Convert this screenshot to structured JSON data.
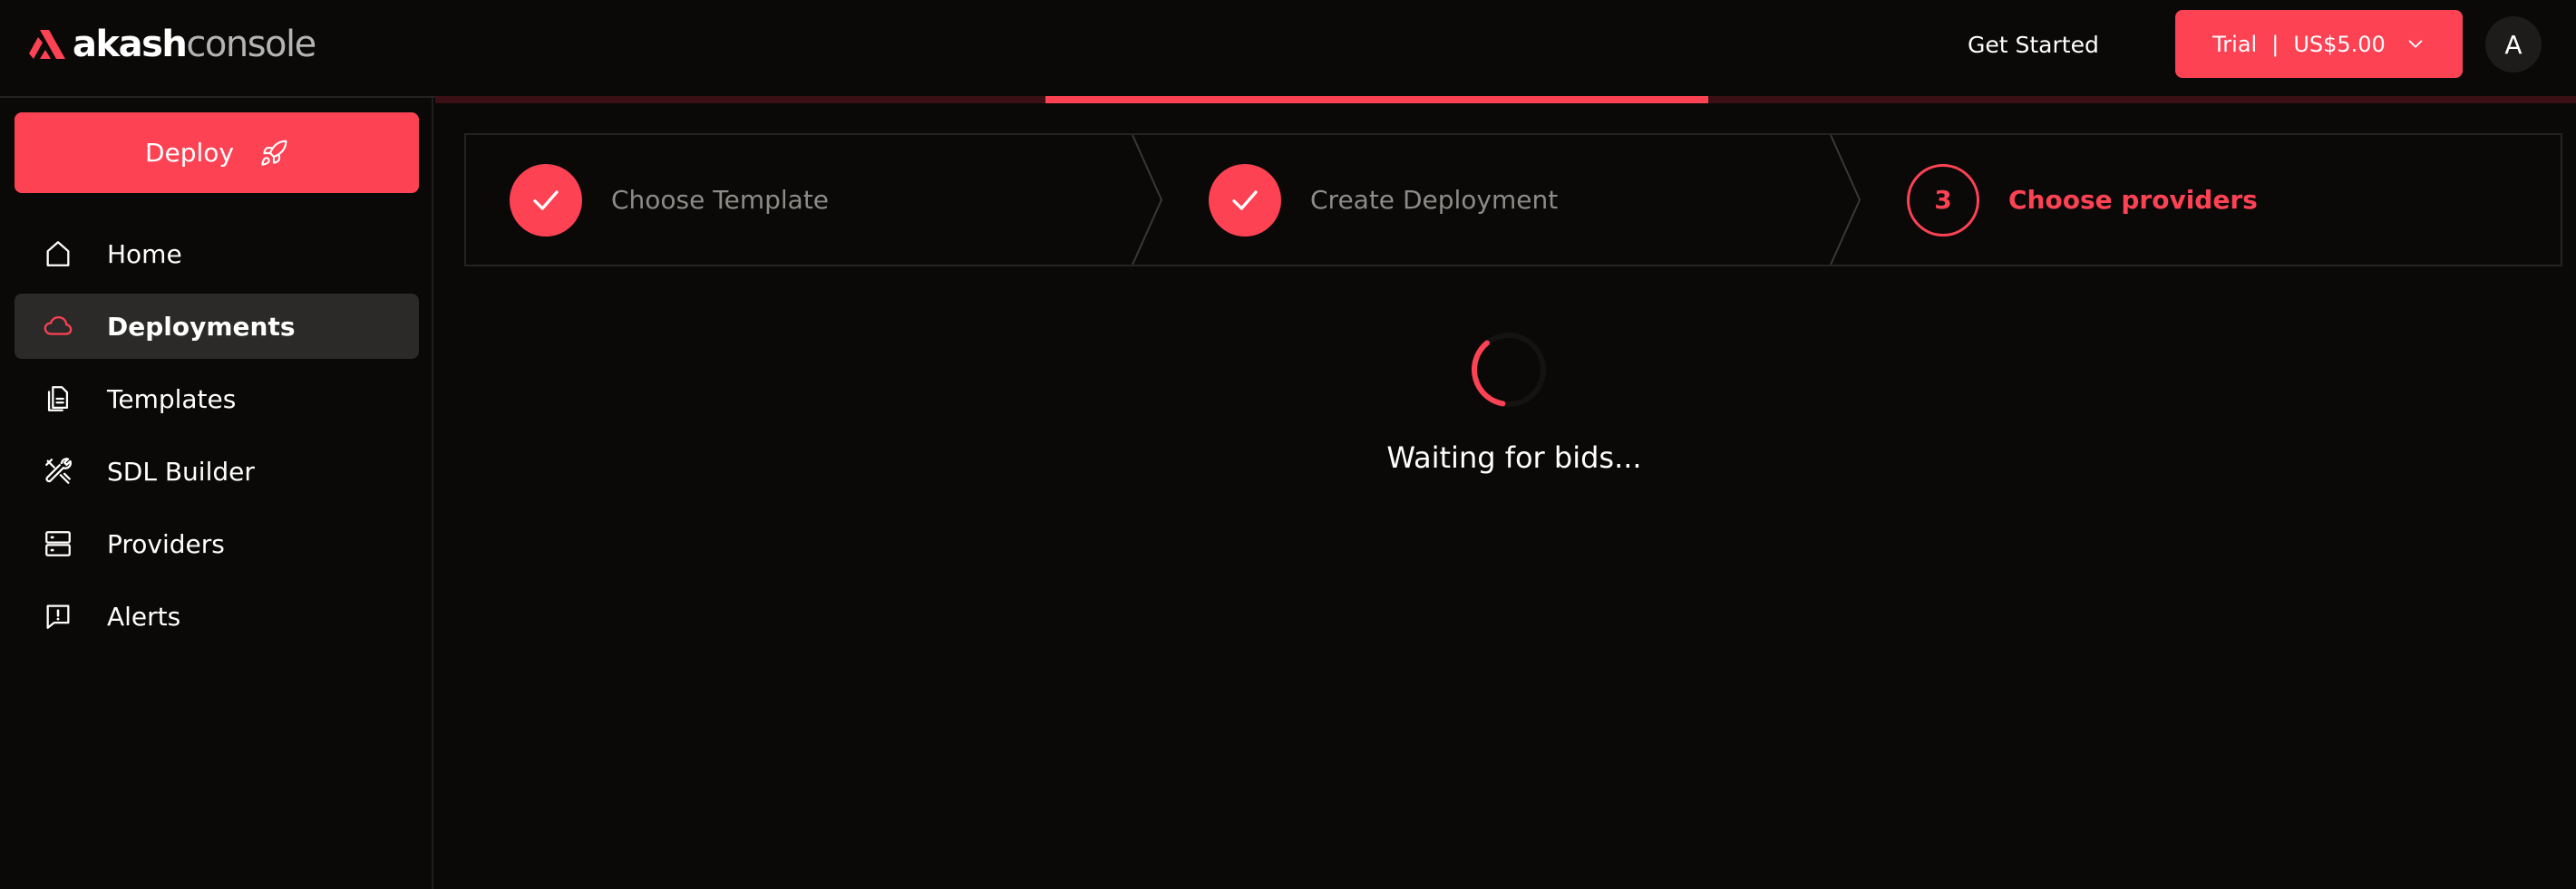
{
  "header": {
    "logo_bold": "akash",
    "logo_light": "console",
    "get_started_label": "Get Started",
    "trial": {
      "label": "Trial",
      "separator": "|",
      "balance": "US$5.00"
    },
    "avatar_initial": "A",
    "progress_fraction": 0.5
  },
  "sidebar": {
    "deploy_label": "Deploy",
    "items": [
      {
        "label": "Home",
        "icon": "home-icon",
        "active": false
      },
      {
        "label": "Deployments",
        "icon": "cloud-icon",
        "active": true
      },
      {
        "label": "Templates",
        "icon": "templates-icon",
        "active": false
      },
      {
        "label": "SDL Builder",
        "icon": "tools-icon",
        "active": false
      },
      {
        "label": "Providers",
        "icon": "server-icon",
        "active": false
      },
      {
        "label": "Alerts",
        "icon": "alert-message-icon",
        "active": false
      }
    ]
  },
  "stepper": {
    "steps": [
      {
        "label": "Choose Template",
        "state": "done"
      },
      {
        "label": "Create Deployment",
        "state": "done"
      },
      {
        "number": "3",
        "label": "Choose providers",
        "state": "current"
      }
    ]
  },
  "status": {
    "waiting_text": "Waiting for bids..."
  },
  "colors": {
    "accent": "#fd4254",
    "background": "#0a0908",
    "active_nav": "#2b2a28",
    "muted_text": "#8d8b88"
  }
}
